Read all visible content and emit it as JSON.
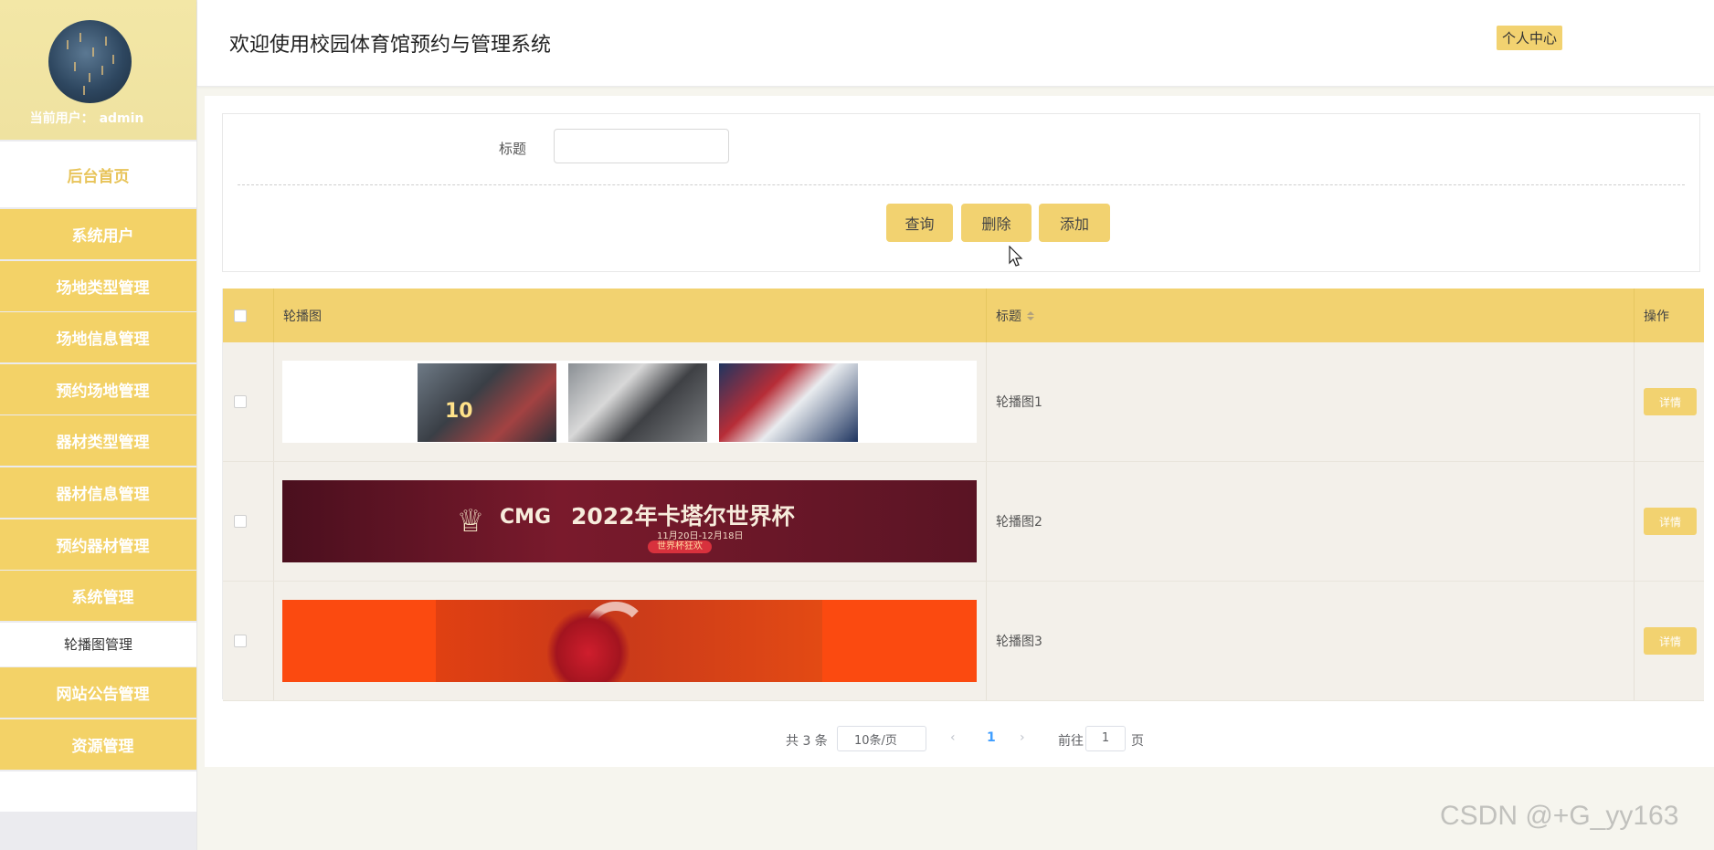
{
  "header": {
    "title": "欢迎使用校园体育馆预约与管理系统",
    "profile_label": "个人中心"
  },
  "sidebar": {
    "current_user_label": "当前用户：",
    "current_user_name": "admin",
    "home_label": "后台首页",
    "items": [
      {
        "label": "系统用户"
      },
      {
        "label": "场地类型管理"
      },
      {
        "label": "场地信息管理"
      },
      {
        "label": "预约场地管理"
      },
      {
        "label": "器材类型管理"
      },
      {
        "label": "器材信息管理"
      },
      {
        "label": "预约器材管理"
      },
      {
        "label": "系统管理"
      }
    ],
    "active_sub_item": "轮播图管理",
    "items_after": [
      {
        "label": "网站公告管理"
      },
      {
        "label": "资源管理"
      }
    ]
  },
  "search": {
    "title_label": "标题",
    "title_value": ""
  },
  "actions": {
    "query": "查询",
    "delete": "删除",
    "add": "添加"
  },
  "table": {
    "columns": {
      "image": "轮播图",
      "title": "标题",
      "operation": "操作"
    },
    "rows": [
      {
        "title": "轮播图1",
        "action": "详情"
      },
      {
        "title": "轮播图2",
        "action": "详情"
      },
      {
        "title": "轮播图3",
        "action": "详情"
      }
    ],
    "banner2": {
      "cmg": "CMG",
      "headline": "2022年卡塔尔世界杯",
      "dates": "11月20日-12月18日",
      "pill": "世界杯狂欢"
    }
  },
  "pagination": {
    "total": "共 3 条",
    "page_size": "10条/页",
    "prev": "‹",
    "current": "1",
    "next": "›",
    "goto_label": "前往",
    "goto_value": "1",
    "goto_unit": "页"
  },
  "watermark": "CSDN @+G_yy163",
  "colors": {
    "accent": "#f2d270",
    "home_text": "#e8c45a",
    "link": "#409eff"
  }
}
